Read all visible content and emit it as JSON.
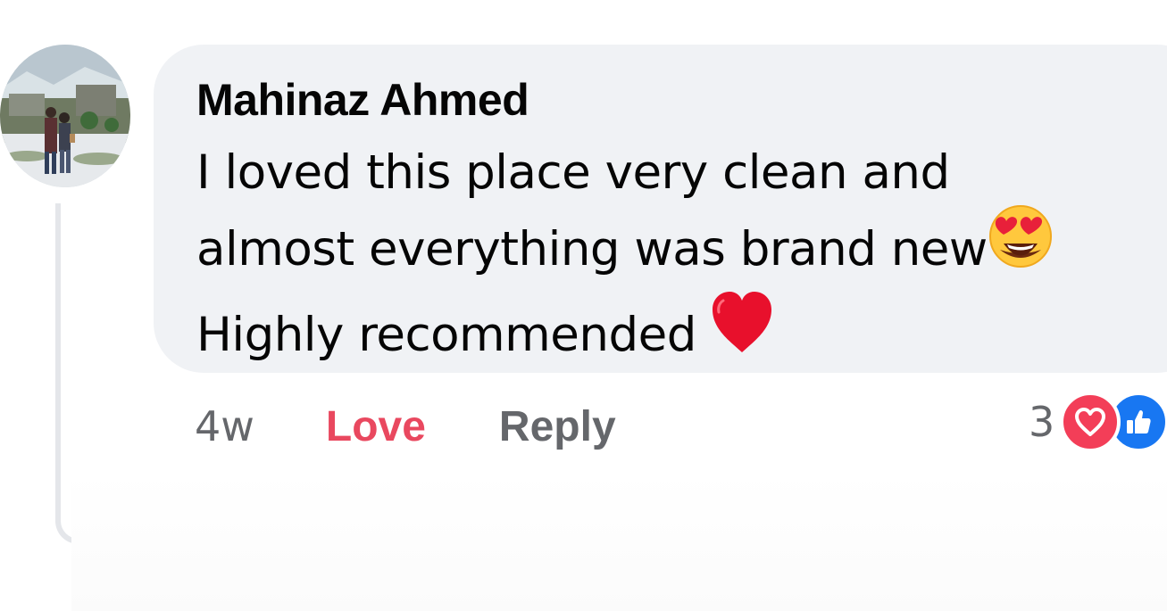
{
  "comment": {
    "author": "Mahinaz Ahmed",
    "text_lines": [
      "I loved this place very clean and",
      "almost everything was brand new",
      "Highly recommended"
    ],
    "line2_emoji": "smiling-face-with-heart-eyes",
    "line3_emoji": "red-heart"
  },
  "actions": {
    "time": "4w",
    "love_label": "Love",
    "reply_label": "Reply"
  },
  "reactions": {
    "count": "3",
    "types": [
      "love-reaction-icon",
      "like-reaction-icon"
    ]
  },
  "colors": {
    "bubble_bg": "#f0f2f5",
    "love_active": "#e9485f",
    "secondary_text": "#65676b",
    "love_reaction": "#f33e58",
    "like_reaction": "#1877f2"
  }
}
